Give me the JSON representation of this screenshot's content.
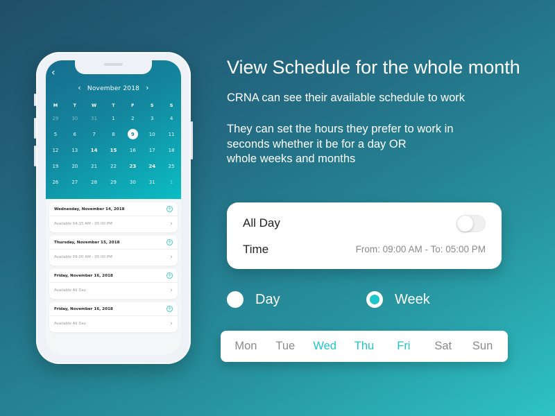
{
  "colors": {
    "accent": "#1fc7ca",
    "background_start": "#1f4f68",
    "background_end": "#2dc3c6",
    "calendar_start": "#186d8f",
    "calendar_end": "#0bbdc4"
  },
  "phone": {
    "back_icon": "chevron-left-icon",
    "calendar": {
      "month_label": "November 2018",
      "prev_icon": "chevron-left-icon",
      "next_icon": "chevron-right-icon",
      "weekdays": [
        "M",
        "T",
        "W",
        "T",
        "F",
        "S",
        "S"
      ],
      "weeks": [
        [
          {
            "d": "29",
            "muted": true
          },
          {
            "d": "30",
            "muted": true
          },
          {
            "d": "31",
            "muted": true
          },
          {
            "d": "1"
          },
          {
            "d": "2"
          },
          {
            "d": "3"
          },
          {
            "d": "4"
          }
        ],
        [
          {
            "d": "5"
          },
          {
            "d": "6"
          },
          {
            "d": "7"
          },
          {
            "d": "8"
          },
          {
            "d": "9",
            "selected": true
          },
          {
            "d": "10"
          },
          {
            "d": "11"
          }
        ],
        [
          {
            "d": "12"
          },
          {
            "d": "13"
          },
          {
            "d": "14",
            "bold": true
          },
          {
            "d": "15",
            "bold": true
          },
          {
            "d": "16"
          },
          {
            "d": "17"
          },
          {
            "d": "18"
          }
        ],
        [
          {
            "d": "19"
          },
          {
            "d": "20"
          },
          {
            "d": "21"
          },
          {
            "d": "22"
          },
          {
            "d": "23",
            "bold": true
          },
          {
            "d": "24",
            "bold": true
          },
          {
            "d": "25"
          }
        ],
        [
          {
            "d": "26"
          },
          {
            "d": "27"
          },
          {
            "d": "28"
          },
          {
            "d": "29"
          },
          {
            "d": "30"
          },
          {
            "d": "31"
          },
          {
            "d": "1",
            "muted": true
          }
        ]
      ]
    },
    "schedule": [
      {
        "date": "Wednesday, November 14, 2018",
        "availability": "Available 04:15 AM - 05:00 PM"
      },
      {
        "date": "Thursday, November 15, 2018",
        "availability": "Available 09:00 AM - 05:00 PM"
      },
      {
        "date": "Friday, November 16, 2018",
        "availability": "Available All Day"
      },
      {
        "date": "Friday, November 16, 2018",
        "availability": "Available All Day"
      }
    ]
  },
  "heading": {
    "title": "View Schedule for the whole month",
    "subtitle": "CRNA can see their available schedule to work",
    "description_lines": [
      "They can set the hours they prefer to work in",
      "seconds whether it be for a day OR",
      "whole weeks and months"
    ]
  },
  "settings_panel": {
    "all_day_label": "All Day",
    "all_day_on": false,
    "time_label": "Time",
    "time_value": "From: 09:00 AM - To: 05:00 PM"
  },
  "range": {
    "options": [
      {
        "label": "Day",
        "selected": false
      },
      {
        "label": "Week",
        "selected": true
      }
    ]
  },
  "weekday_picker": {
    "days": [
      {
        "label": "Mon",
        "active": false
      },
      {
        "label": "Tue",
        "active": false
      },
      {
        "label": "Wed",
        "active": true
      },
      {
        "label": "Thu",
        "active": true
      },
      {
        "label": "Fri",
        "active": true
      },
      {
        "label": "Sat",
        "active": false
      },
      {
        "label": "Sun",
        "active": false
      }
    ]
  }
}
